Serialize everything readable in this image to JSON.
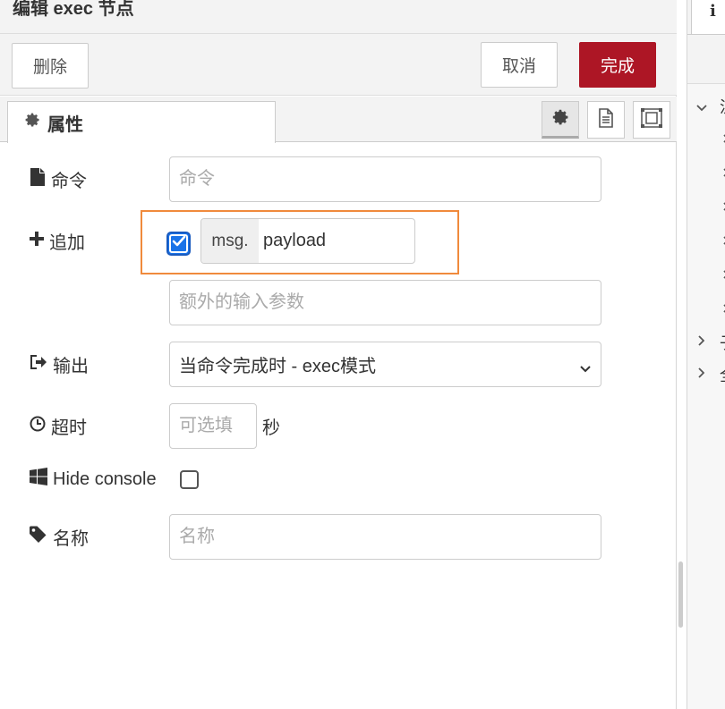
{
  "tray": {
    "title": "编辑 exec 节点",
    "buttons": {
      "delete": "删除",
      "cancel": "取消",
      "done": "完成"
    },
    "tab_label": "属性"
  },
  "form": {
    "command": {
      "label": "命令",
      "placeholder": "命令",
      "icon": "file-icon"
    },
    "append": {
      "label": "追加",
      "checked": true,
      "type_prefix": "msg.",
      "value": "payload",
      "extra_placeholder": "额外的输入参数",
      "icon": "plus-icon"
    },
    "output": {
      "label": "输出",
      "selected": "当命令完成时 - exec模式",
      "icon": "sign-out-icon"
    },
    "timeout": {
      "label": "超时",
      "placeholder": "可选填",
      "unit": "秒",
      "icon": "clock-icon"
    },
    "hide_console": {
      "label": "Hide console",
      "checked": false,
      "icon": "windows-icon"
    },
    "name": {
      "label": "名称",
      "placeholder": "名称",
      "icon": "tag-icon"
    }
  },
  "sidebar": {
    "info_tab": "i",
    "items": [
      {
        "text": "流",
        "expanded": true
      },
      {
        "text": "子",
        "expanded": false
      },
      {
        "text": "全",
        "expanded": false
      }
    ]
  },
  "colors": {
    "done_button": "#ad1625",
    "highlight": "#f08a3c",
    "checkbox": "#1a73e8"
  }
}
